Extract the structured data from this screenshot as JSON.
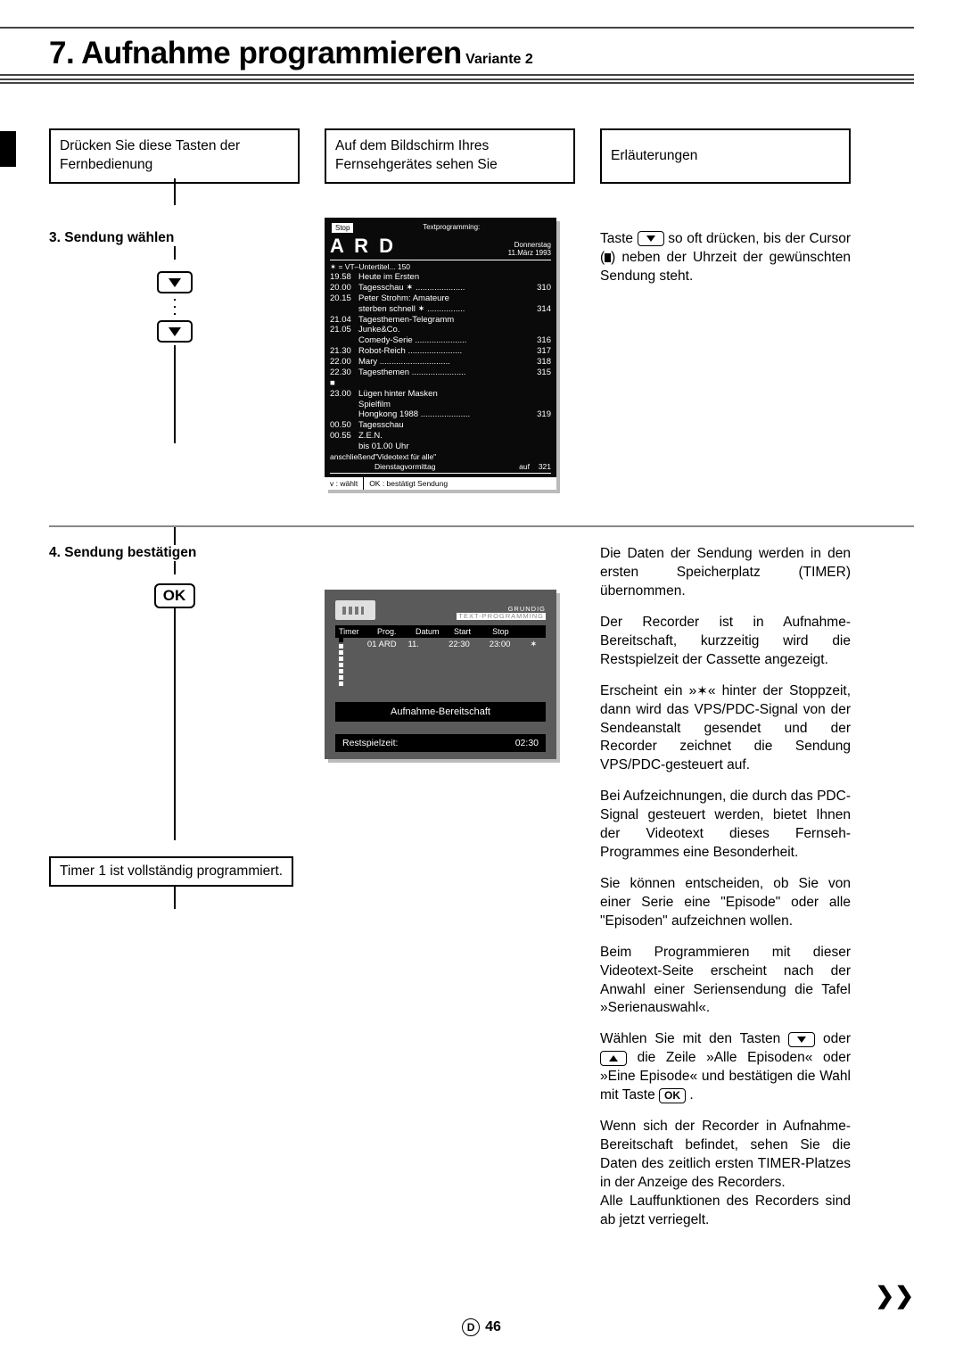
{
  "header": {
    "title_main": "7. Aufnahme programmieren",
    "title_sub": "Variante 2"
  },
  "col_heads": {
    "left": "Drücken Sie diese Tasten der Fernbedienung",
    "mid": "Auf dem Bildschirm Ihres Fernsehgerätes sehen Sie",
    "right": "Erläuterungen"
  },
  "step3": {
    "title": "3. Sendung wählen",
    "explain_pre": "Taste ",
    "explain_mid": " so oft drücken, bis der Cursor (",
    "explain_post": ") neben der Uhrzeit der gewünschten Sendung steht."
  },
  "teletext": {
    "stop": "Stop",
    "topbar": "Textprogramming:",
    "logo": "A R D",
    "date1": "Donnerstag",
    "date2": "11.März 1993",
    "untertitel": "✶ = VT–Untertitel... 150",
    "rows": [
      {
        "t": "19.58",
        "txt": "Heute im Ersten",
        "n": ""
      },
      {
        "t": "20.00",
        "txt": "Tagesschau  ✶",
        "dots": true,
        "n": "310"
      },
      {
        "t": "20.15",
        "txt": "Peter Strohm: Amateure",
        "n": ""
      },
      {
        "t": "",
        "txt": "sterben schnell  ✶",
        "dots": true,
        "n": "314"
      },
      {
        "t": "21.04",
        "txt": "Tagesthemen-Telegramm",
        "n": ""
      },
      {
        "t": "21.05",
        "txt": "Junke&Co.",
        "n": ""
      },
      {
        "t": "",
        "txt": "Comedy-Serie",
        "dots": true,
        "n": "316"
      },
      {
        "t": "21.30",
        "txt": "Robot-Reich",
        "dots": true,
        "n": "317"
      },
      {
        "t": "22.00",
        "txt": "Mary",
        "dots": true,
        "n": "318"
      },
      {
        "t": "22.30 ■",
        "txt": "Tagesthemen",
        "dots": true,
        "n": "315"
      },
      {
        "t": "23.00",
        "txt": "Lügen hinter Masken",
        "n": ""
      },
      {
        "t": "",
        "txt": "Spielfilm",
        "n": ""
      },
      {
        "t": "",
        "txt": "Hongkong 1988",
        "dots": true,
        "n": "319"
      },
      {
        "t": "00.50",
        "txt": "Tagesschau",
        "n": ""
      },
      {
        "t": "00.55",
        "txt": "Z.E.N.",
        "n": ""
      },
      {
        "t": "",
        "txt": "bis 01.00 Uhr",
        "n": ""
      }
    ],
    "ansch_label": "anschließend",
    "ansch1": "\"Videotext für alle\"",
    "ansch2": "Dienstagvormittag",
    "auf": "auf",
    "aufnum": "321",
    "foot1": "v : wählt",
    "foot2": "OK : bestätigt Sendung"
  },
  "step4": {
    "title": "4. Sendung bestätigen",
    "ok": "OK",
    "note": "Timer 1 ist vollständig programmiert."
  },
  "timer": {
    "brand": "GRUNDIG",
    "brand2": "TEXT-PROGRAMMING",
    "thead": [
      "Timer",
      "Prog.",
      "Datum",
      "Start",
      "Stop",
      ""
    ],
    "row": [
      "",
      "01 ARD",
      "11.",
      "22:30",
      "23:00",
      "✶"
    ],
    "banner": "Aufnahme-Bereitschaft",
    "rest_label": "Restspielzeit:",
    "rest_value": "02:30"
  },
  "explain4": {
    "p1": "Die Daten der Sendung werden in den ersten Speicherplatz (TIMER) übernommen.",
    "p2": "Der Recorder ist in Aufnahme-Bereitschaft, kurzzeitig wird die Restspielzeit der Cassette angezeigt.",
    "p3_a": "Erscheint ein »",
    "p3_b": "« hinter der Stoppzeit, dann wird das VPS/PDC-Signal von der Sendeanstalt gesendet und der Recorder zeichnet die Sendung VPS/PDC-gesteuert auf.",
    "p4": "Bei Aufzeichnungen, die durch das PDC-Signal gesteuert werden, bietet Ihnen der Videotext dieses Fernseh-Programmes eine Besonderheit.",
    "p5": "Sie können entscheiden, ob Sie von einer Serie eine \"Episode\" oder alle \"Episoden\" aufzeichnen wollen.",
    "p6": "Beim Programmieren mit dieser Videotext-Seite erscheint nach der Anwahl einer Seriensendung die Tafel »Serienauswahl«.",
    "p7_a": "Wählen Sie mit den Tasten ",
    "p7_b": " oder ",
    "p7_c": " die Zeile »Alle Episoden« oder »Eine Episode« und bestätigen die Wahl mit Taste ",
    "p7_d": " .",
    "p8": "Wenn sich der Recorder in Aufnahme-Bereitschaft befindet, sehen Sie die Daten des zeitlich ersten TIMER-Platzes in der Anzeige des Recorders.",
    "p9": "Alle Lauffunktionen des Recorders sind ab jetzt verriegelt."
  },
  "footer": {
    "lang": "D",
    "page": "46"
  }
}
